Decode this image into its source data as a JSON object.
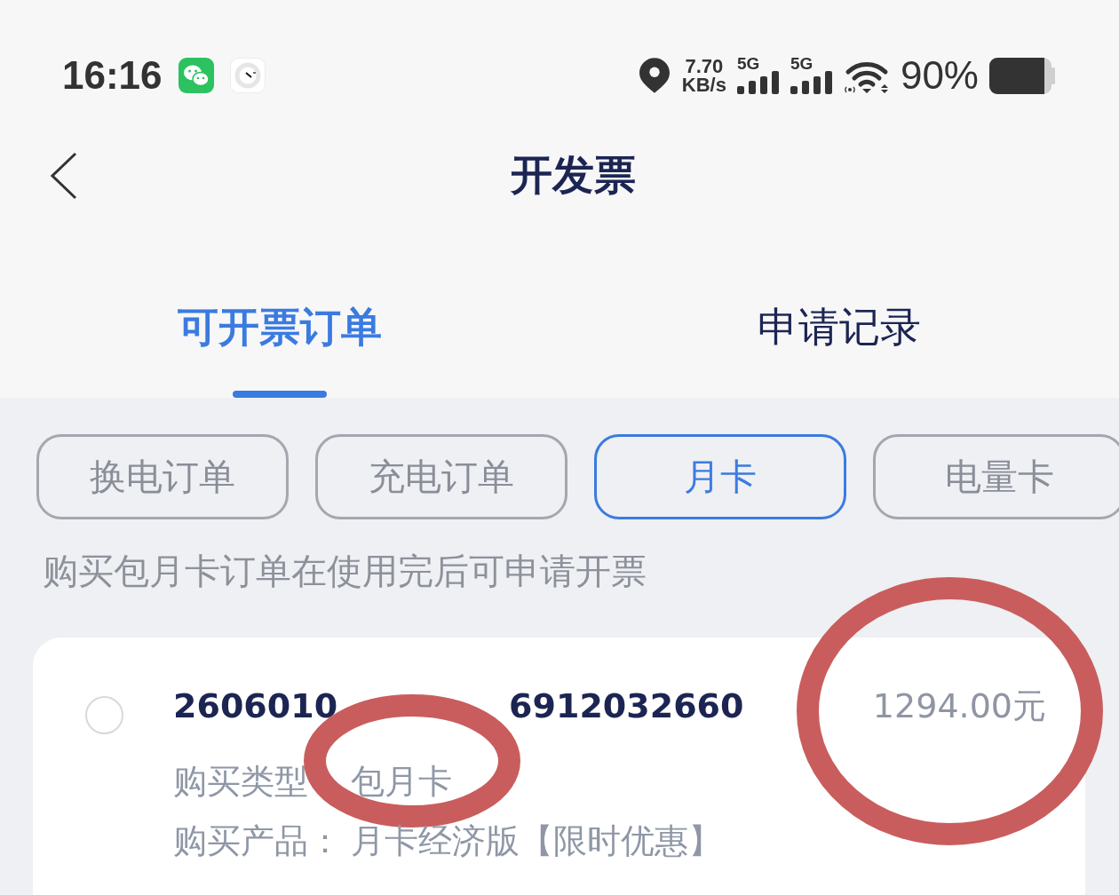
{
  "status_bar": {
    "time": "16:16",
    "net_speed": {
      "value": "7.70",
      "unit": "KB/s"
    },
    "signals": [
      {
        "label": "5G"
      },
      {
        "label": "5G"
      }
    ],
    "battery_text": "90%"
  },
  "header": {
    "title": "开发票"
  },
  "tabs": [
    {
      "label": "可开票订单",
      "selected": true
    },
    {
      "label": "申请记录",
      "selected": false
    }
  ],
  "filters": [
    {
      "label": "换电订单",
      "selected": false
    },
    {
      "label": "充电订单",
      "selected": false
    },
    {
      "label": "月卡",
      "selected": true
    },
    {
      "label": "电量卡",
      "selected": false
    }
  ],
  "hint": "购买包月卡订单在使用完后可申请开票",
  "orders": [
    {
      "selected": false,
      "order_number": {
        "visible_start": "2606010",
        "visible_end": "6912032660"
      },
      "price": {
        "text": "1294.00元",
        "circled": true
      },
      "details": [
        {
          "label": "购买类型",
          "value": "包月卡",
          "circled": true
        },
        {
          "label": "购买产品：",
          "value": "月卡经济版【限时优惠】",
          "circled": false
        }
      ]
    }
  ]
}
